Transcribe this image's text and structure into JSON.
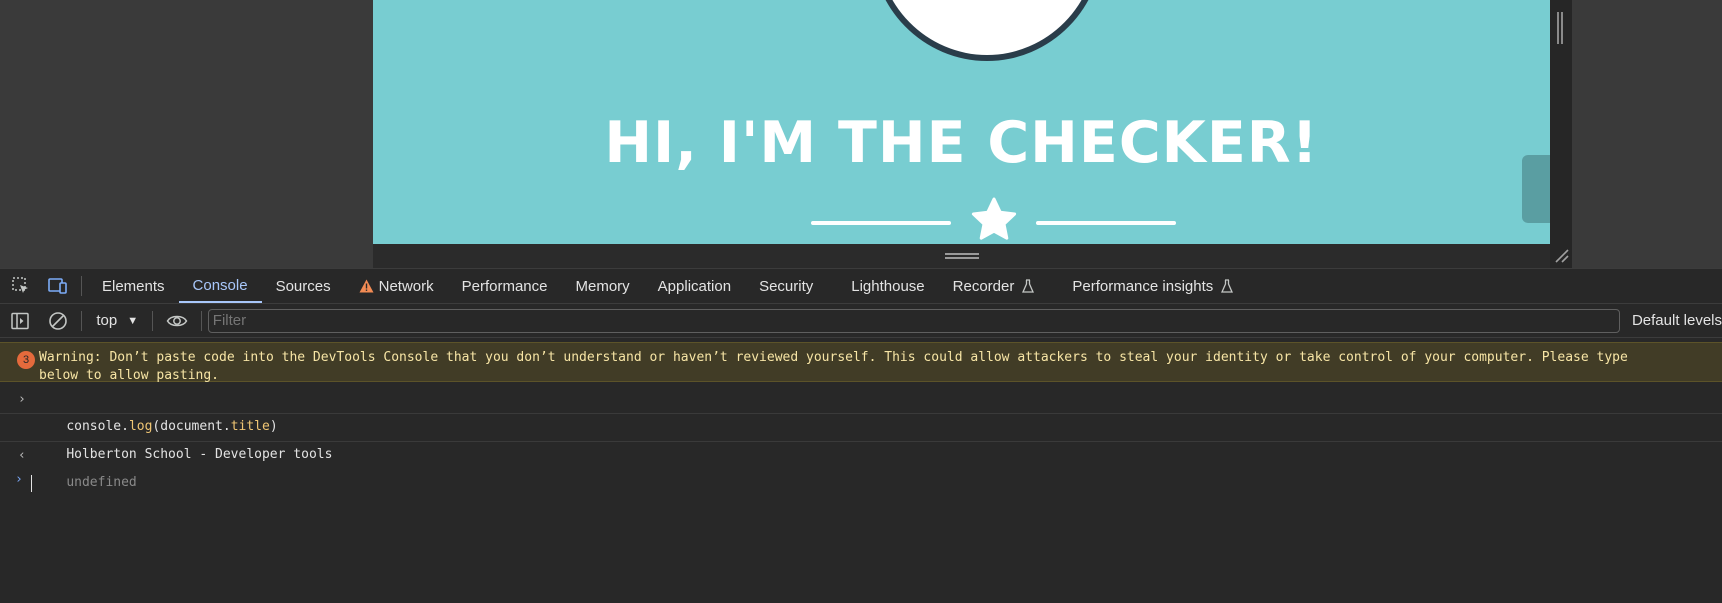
{
  "page_preview": {
    "hero_title": "HI, I'M THE CHECKER!",
    "background_color": "#78cdd1"
  },
  "devtools": {
    "tabs": [
      {
        "label": "Elements"
      },
      {
        "label": "Console"
      },
      {
        "label": "Sources"
      },
      {
        "label": "Network"
      },
      {
        "label": "Performance"
      },
      {
        "label": "Memory"
      },
      {
        "label": "Application"
      },
      {
        "label": "Security"
      },
      {
        "label": "Lighthouse"
      },
      {
        "label": "Recorder"
      },
      {
        "label": "Performance insights"
      }
    ],
    "active_tab": "Console"
  },
  "console_toolbar": {
    "context": "top",
    "filter_placeholder": "Filter",
    "levels_label": "Default levels"
  },
  "console": {
    "warning_count": "3",
    "warning_line1": "Warning: Don’t paste code into the DevTools Console that you don’t understand or haven’t reviewed yourself. This could allow attackers to steal your identity or take control of your computer. Please type",
    "warning_line2": "below to allow pasting.",
    "input_obj": "console.",
    "input_method": "log",
    "input_arg_open": "(document.",
    "input_prop": "title",
    "input_close": ")",
    "output": "Holberton School - Developer tools",
    "return_value": "undefined"
  }
}
